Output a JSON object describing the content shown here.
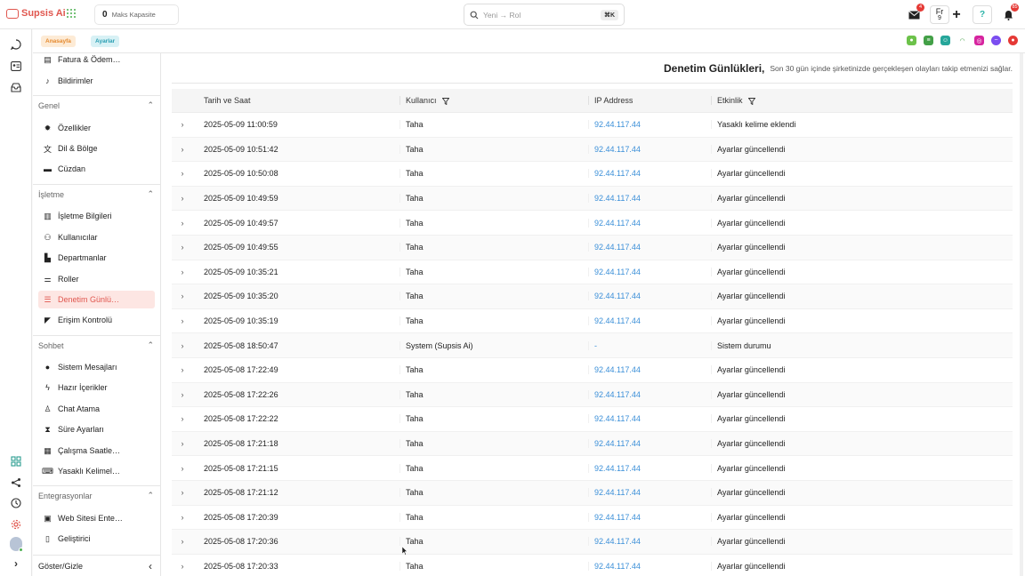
{
  "app": {
    "name": "Supsis Ai",
    "capacity_value": "0",
    "capacity_label": "Maks Kapasite"
  },
  "search": {
    "placeholder": "Yeni → Rol",
    "shortcut": "⌘K"
  },
  "topbar": {
    "mail_badge": "4",
    "fr_label": "Fr",
    "fr_sub": "9",
    "notif_badge": "85"
  },
  "breadcrumbs": [
    "Anasayfa",
    "Ayarlar"
  ],
  "colors": {
    "brand": "#e0574f",
    "link": "#3b8fd8",
    "active_bg": "#fde6e3"
  },
  "sidebar": {
    "top_items": [
      {
        "label": "Fatura & Ödem…",
        "icon": "invoice-icon"
      },
      {
        "label": "Bildirimler",
        "icon": "bell-icon"
      }
    ],
    "groups": [
      {
        "title": "Genel",
        "items": [
          {
            "label": "Özellikler",
            "icon": "gear-icon"
          },
          {
            "label": "Dil & Bölge",
            "icon": "translate-icon"
          },
          {
            "label": "Cüzdan",
            "icon": "wallet-icon"
          }
        ]
      },
      {
        "title": "İşletme",
        "items": [
          {
            "label": "İşletme Bilgileri",
            "icon": "building-icon"
          },
          {
            "label": "Kullanıcılar",
            "icon": "users-icon"
          },
          {
            "label": "Departmanlar",
            "icon": "department-icon"
          },
          {
            "label": "Roller",
            "icon": "roles-icon"
          },
          {
            "label": "Denetim Günlü…",
            "icon": "list-icon",
            "active": true
          },
          {
            "label": "Erişim Kontrolü",
            "icon": "access-icon"
          }
        ]
      },
      {
        "title": "Sohbet",
        "items": [
          {
            "label": "Sistem Mesajları",
            "icon": "bomb-icon"
          },
          {
            "label": "Hazır İçerikler",
            "icon": "bolt-icon"
          },
          {
            "label": "Chat Atama",
            "icon": "person-icon"
          },
          {
            "label": "Süre Ayarları",
            "icon": "hourglass-icon"
          },
          {
            "label": "Çalışma Saatle…",
            "icon": "calendar-icon"
          },
          {
            "label": "Yasaklı Kelimel…",
            "icon": "keyboard-icon"
          }
        ]
      },
      {
        "title": "Entegrasyonlar",
        "items": [
          {
            "label": "Web Sitesi Ente…",
            "icon": "website-icon"
          },
          {
            "label": "Geliştirici",
            "icon": "developer-icon"
          }
        ]
      }
    ],
    "footer": "Göster/Gizle"
  },
  "header": {
    "title": "Denetim Günlükleri,",
    "description": "Son 30 gün içinde şirketinizde gerçekleşen olayları takip etmenizi sağlar."
  },
  "table": {
    "columns": [
      "Tarih ve Saat",
      "Kullanıcı",
      "IP Address",
      "Etkinlik"
    ],
    "rows": [
      {
        "date": "2025-05-09 11:00:59",
        "user": "Taha",
        "ip": "92.44.117.44",
        "activity": "Yasaklı kelime eklendi"
      },
      {
        "date": "2025-05-09 10:51:42",
        "user": "Taha",
        "ip": "92.44.117.44",
        "activity": "Ayarlar güncellendi"
      },
      {
        "date": "2025-05-09 10:50:08",
        "user": "Taha",
        "ip": "92.44.117.44",
        "activity": "Ayarlar güncellendi"
      },
      {
        "date": "2025-05-09 10:49:59",
        "user": "Taha",
        "ip": "92.44.117.44",
        "activity": "Ayarlar güncellendi"
      },
      {
        "date": "2025-05-09 10:49:57",
        "user": "Taha",
        "ip": "92.44.117.44",
        "activity": "Ayarlar güncellendi"
      },
      {
        "date": "2025-05-09 10:49:55",
        "user": "Taha",
        "ip": "92.44.117.44",
        "activity": "Ayarlar güncellendi"
      },
      {
        "date": "2025-05-09 10:35:21",
        "user": "Taha",
        "ip": "92.44.117.44",
        "activity": "Ayarlar güncellendi"
      },
      {
        "date": "2025-05-09 10:35:20",
        "user": "Taha",
        "ip": "92.44.117.44",
        "activity": "Ayarlar güncellendi"
      },
      {
        "date": "2025-05-09 10:35:19",
        "user": "Taha",
        "ip": "92.44.117.44",
        "activity": "Ayarlar güncellendi"
      },
      {
        "date": "2025-05-08 18:50:47",
        "user": "System (Supsis Ai)",
        "ip": "-",
        "activity": "Sistem durumu"
      },
      {
        "date": "2025-05-08 17:22:49",
        "user": "Taha",
        "ip": "92.44.117.44",
        "activity": "Ayarlar güncellendi"
      },
      {
        "date": "2025-05-08 17:22:26",
        "user": "Taha",
        "ip": "92.44.117.44",
        "activity": "Ayarlar güncellendi"
      },
      {
        "date": "2025-05-08 17:22:22",
        "user": "Taha",
        "ip": "92.44.117.44",
        "activity": "Ayarlar güncellendi"
      },
      {
        "date": "2025-05-08 17:21:18",
        "user": "Taha",
        "ip": "92.44.117.44",
        "activity": "Ayarlar güncellendi"
      },
      {
        "date": "2025-05-08 17:21:15",
        "user": "Taha",
        "ip": "92.44.117.44",
        "activity": "Ayarlar güncellendi"
      },
      {
        "date": "2025-05-08 17:21:12",
        "user": "Taha",
        "ip": "92.44.117.44",
        "activity": "Ayarlar güncellendi"
      },
      {
        "date": "2025-05-08 17:20:39",
        "user": "Taha",
        "ip": "92.44.117.44",
        "activity": "Ayarlar güncellendi"
      },
      {
        "date": "2025-05-08 17:20:36",
        "user": "Taha",
        "ip": "92.44.117.44",
        "activity": "Ayarlar güncellendi"
      },
      {
        "date": "2025-05-08 17:20:33",
        "user": "Taha",
        "ip": "92.44.117.44",
        "activity": "Ayarlar güncellendi"
      }
    ]
  }
}
